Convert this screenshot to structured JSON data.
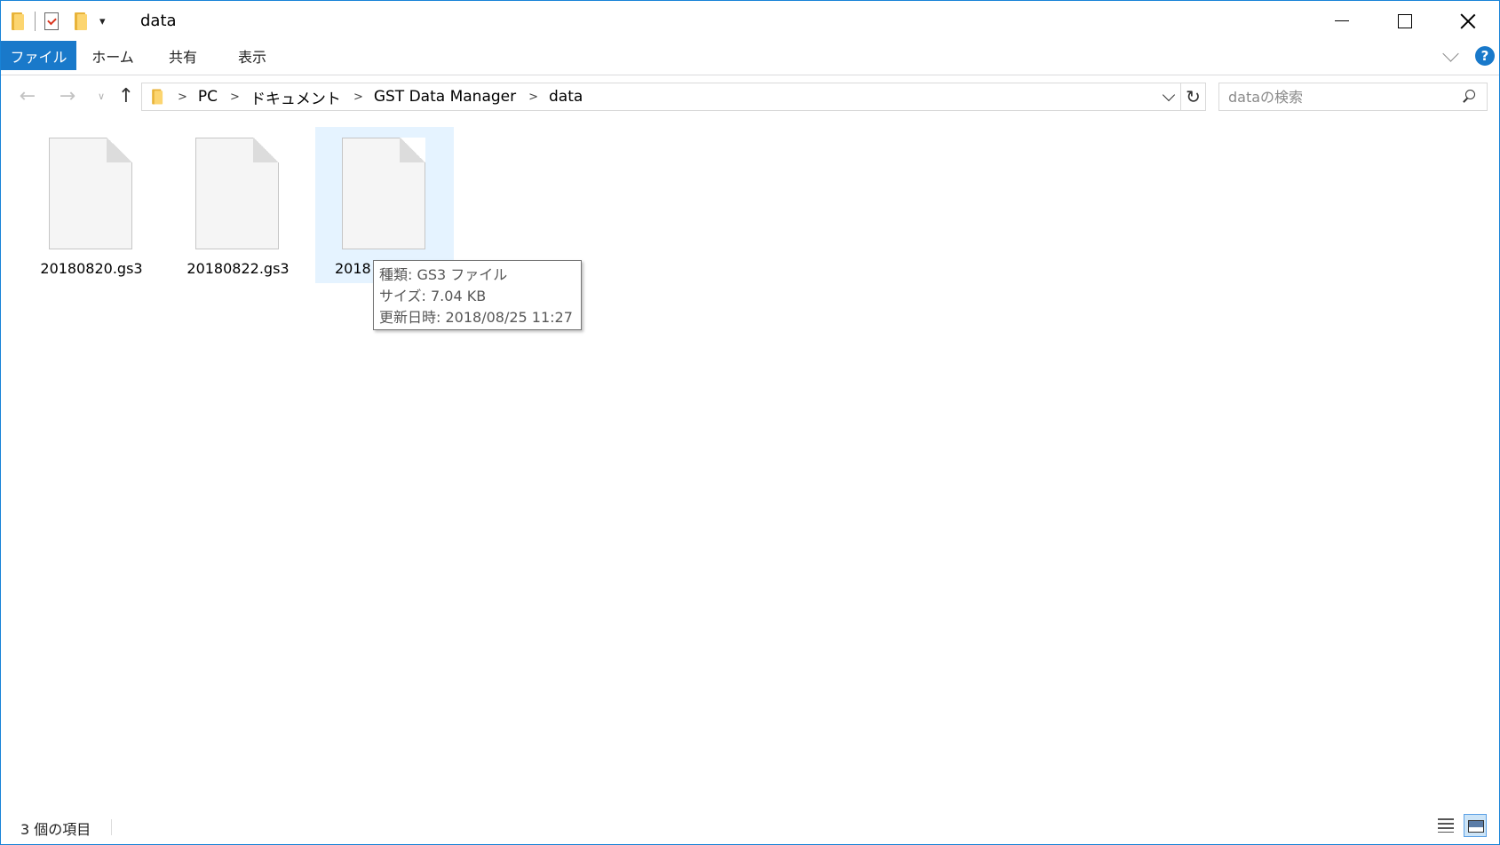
{
  "window": {
    "title": "data",
    "accent": "#1979ca",
    "border": "#1883d7"
  },
  "ribbon": {
    "tabs": [
      {
        "label": "ファイル",
        "active": true
      },
      {
        "label": "ホーム"
      },
      {
        "label": "共有"
      },
      {
        "label": "表示"
      }
    ],
    "help_label": "?"
  },
  "navigation": {
    "breadcrumb": [
      "PC",
      "ドキュメント",
      "GST Data Manager",
      "data"
    ],
    "crumb_separator": ">",
    "search_placeholder": "dataの検索"
  },
  "files": [
    {
      "name": "20180820.gs3",
      "selected": false
    },
    {
      "name": "20180822.gs3",
      "selected": false
    },
    {
      "name": "2018",
      "selected": true
    }
  ],
  "tooltip": {
    "type_line": "種類: GS3 ファイル",
    "size_line": "サイズ: 7.04 KB",
    "modified_line": "更新日時: 2018/08/25 11:27"
  },
  "status": {
    "item_count": "3 個の項目"
  },
  "icons": {
    "back": "arrow-left-icon",
    "forward": "arrow-right-icon",
    "recent": "chevron-down-icon",
    "up": "arrow-up-icon",
    "refresh": "refresh-icon",
    "search": "search-icon"
  }
}
